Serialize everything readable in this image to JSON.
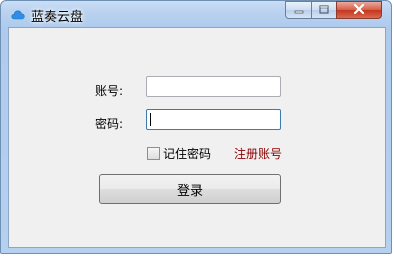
{
  "window": {
    "title": "蓝奏云盘",
    "app_icon": "cloud-icon"
  },
  "titlebar_buttons": {
    "minimize": "minimize-icon",
    "maximize": "maximize-icon",
    "close": "close-icon"
  },
  "form": {
    "account_label": "账号:",
    "account_value": "",
    "password_label": "密码:",
    "password_value": "",
    "remember_label": "记住密码",
    "remember_checked": false,
    "register_link": "注册账号",
    "login_button": "登录"
  },
  "colors": {
    "register_link": "#8b0000",
    "close_button": "#c4361d",
    "title_bar": "#b9d2ef",
    "client_bg": "#f0f0f0"
  }
}
